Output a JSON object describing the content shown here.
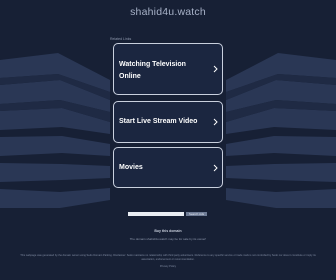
{
  "header": {
    "domain": "shahid4u.watch"
  },
  "related": {
    "heading": "Related Links",
    "links": [
      {
        "label": "Watching Television Online"
      },
      {
        "label": "Start Live Stream Video"
      },
      {
        "label": "Movies"
      }
    ]
  },
  "search": {
    "placeholder": "",
    "button_label": "Search Ads"
  },
  "footer": {
    "buy_link": "Buy this domain",
    "owner_note": "The domain shahid4u.watch may be for sale by its owner!",
    "disclaimer": "This webpage was generated by the domain owner using Sedo Domain Parking. Disclaimer: Sedo maintains no relationship with third party advertisers. Reference to any specific service or trade mark is not controlled by Sedo nor does it constitute or imply its association, endorsement or recommendation.",
    "privacy": "Privacy Policy"
  },
  "colors": {
    "background": "#172035",
    "card_border": "#c9d0de",
    "card_text": "#ffffff"
  },
  "icons": {
    "card_arrow": "chevron-right-icon"
  }
}
